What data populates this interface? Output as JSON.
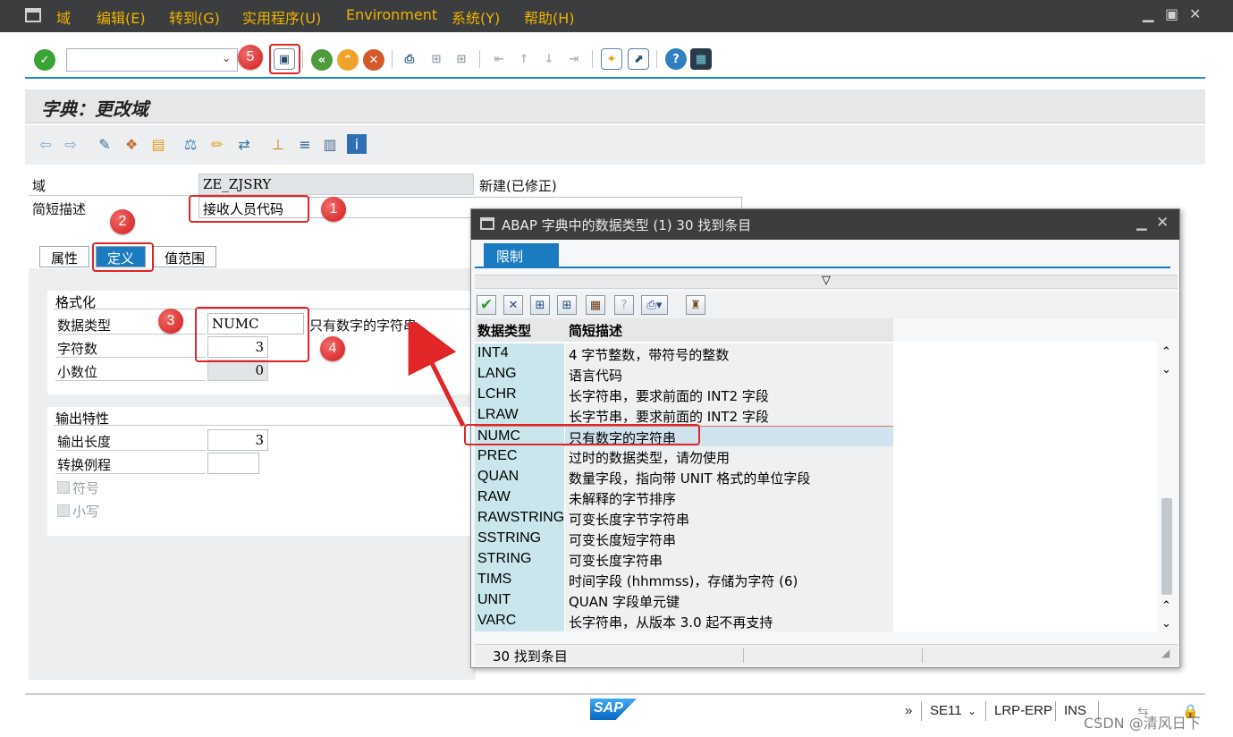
{
  "menu": {
    "items": [
      "域",
      "编辑(E)",
      "转到(G)",
      "实用程序(U)",
      "Environment",
      "系统(Y)",
      "帮助(H)"
    ]
  },
  "window_controls": [
    "minimize",
    "restore",
    "close"
  ],
  "toolbar": {
    "command_field_value": "",
    "icons": [
      "enter-check",
      "command-dropdown",
      "save",
      "back",
      "exit",
      "cancel",
      "print",
      "find",
      "find-next",
      "first-page",
      "prev-page",
      "next-page",
      "last-page",
      "new-session",
      "shortcut",
      "help",
      "customize-layout"
    ]
  },
  "page": {
    "title": "字典：更改域"
  },
  "app_toolbar": {
    "icons": [
      "back-arrow",
      "forward-arrow",
      "display-change",
      "other-object",
      "object-list",
      "check",
      "activate",
      "where-used",
      "hierarchy",
      "object-directory",
      "documentation",
      "information"
    ]
  },
  "header": {
    "domain_label": "域",
    "domain_value": "ZE_ZJSRY",
    "domain_status": "新建(已修正)",
    "desc_label": "简短描述",
    "desc_value": "接收人员代码"
  },
  "tabs": [
    "属性",
    "定义",
    "值范围"
  ],
  "active_tab": "定义",
  "format_group": {
    "title": "格式化",
    "datatype_label": "数据类型",
    "datatype_value": "NUMC",
    "datatype_desc": "只有数字的字符串",
    "length_label": "字符数",
    "length_value": "3",
    "decimals_label": "小数位",
    "decimals_value": "0"
  },
  "output_group": {
    "title": "输出特性",
    "outlen_label": "输出长度",
    "outlen_value": "3",
    "convexit_label": "转换例程",
    "convexit_value": "",
    "sign_label": "符号",
    "lowercase_label": "小写"
  },
  "annotations": [
    "1",
    "2",
    "3",
    "4",
    "5"
  ],
  "popup": {
    "title": "ABAP 字典中的数据类型 (1)   30 找到条目",
    "restrict_tab": "限制",
    "filter_marker": "▽",
    "col_type": "数据类型",
    "col_desc": "简短描述",
    "rows": [
      {
        "type": "INT4",
        "desc": "4 字节整数，带符号的整数"
      },
      {
        "type": "LANG",
        "desc": "语言代码"
      },
      {
        "type": "LCHR",
        "desc": "长字符串，要求前面的 INT2 字段"
      },
      {
        "type": "LRAW",
        "desc": "长字节串，要求前面的 INT2 字段"
      },
      {
        "type": "NUMC",
        "desc": "只有数字的字符串"
      },
      {
        "type": "PREC",
        "desc": "过时的数据类型，请勿使用"
      },
      {
        "type": "QUAN",
        "desc": "数量字段，指向带 UNIT 格式的单位字段"
      },
      {
        "type": "RAW",
        "desc": "未解释的字节排序"
      },
      {
        "type": "RAWSTRING",
        "desc": "可变长度字节字符串"
      },
      {
        "type": "SSTRING",
        "desc": "可变长度短字符串"
      },
      {
        "type": "STRING",
        "desc": "可变长度字符串"
      },
      {
        "type": "TIMS",
        "desc": "时间字段 (hhmmss)，存储为字符 (6)"
      },
      {
        "type": "UNIT",
        "desc": "QUAN 字段单元键"
      },
      {
        "type": "VARC",
        "desc": "长字符串，从版本 3.0 起不再支持"
      }
    ],
    "selected_row": "NUMC",
    "status": "30 找到条目"
  },
  "statusbar": {
    "logo": "SAP",
    "more": "»",
    "transaction": "SE11",
    "system": "LRP-ERP",
    "mode": "INS"
  },
  "watermark": "CSDN @清风日下"
}
